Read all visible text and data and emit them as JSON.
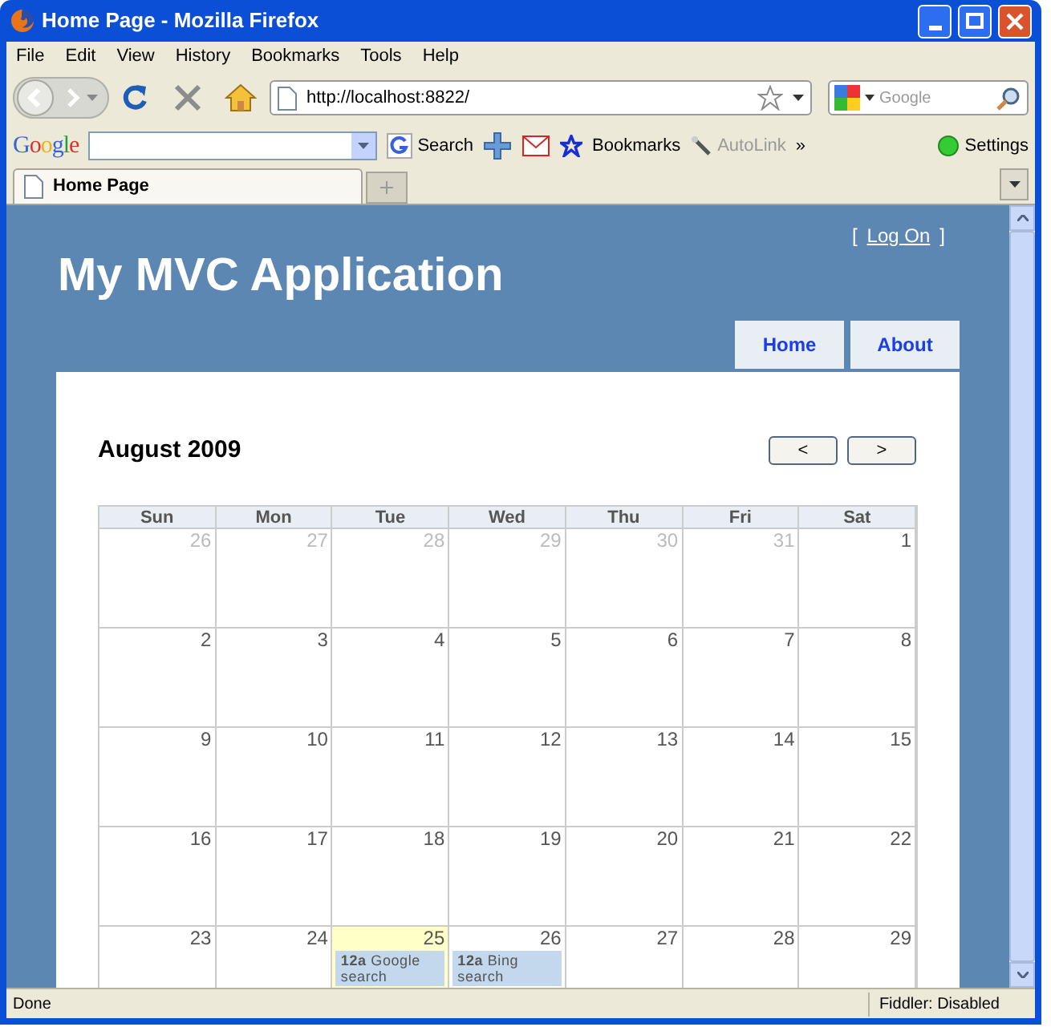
{
  "window": {
    "title": "Home Page - Mozilla Firefox"
  },
  "menu": [
    "File",
    "Edit",
    "View",
    "History",
    "Bookmarks",
    "Tools",
    "Help"
  ],
  "nav": {
    "url": "http://localhost:8822/",
    "search_placeholder": "Google"
  },
  "google_toolbar": {
    "logo": "Google",
    "items": [
      {
        "kind": "search",
        "label": "Search",
        "disabled": false
      },
      {
        "kind": "bookmarks",
        "label": "Bookmarks",
        "disabled": false
      },
      {
        "kind": "autolink",
        "label": "AutoLink",
        "disabled": true
      },
      {
        "kind": "more",
        "label": "»",
        "disabled": false
      }
    ],
    "settings": "Settings"
  },
  "tabs": [
    {
      "title": "Home Page",
      "selected": true
    }
  ],
  "page": {
    "log_on": {
      "before": "[",
      "link": "Log On",
      "after": "]"
    },
    "title": "My MVC Application",
    "menu": [
      {
        "label": "Home",
        "selected": false
      },
      {
        "label": "About",
        "selected": false
      }
    ],
    "calendar": {
      "month": "August 2009",
      "prev": "<",
      "next": ">",
      "weekdays": [
        "Sun",
        "Mon",
        "Tue",
        "Wed",
        "Thu",
        "Fri",
        "Sat"
      ],
      "weeks": [
        [
          {
            "day": "26",
            "other_month": true
          },
          {
            "day": "27",
            "other_month": true
          },
          {
            "day": "28",
            "other_month": true
          },
          {
            "day": "29",
            "other_month": true
          },
          {
            "day": "30",
            "other_month": true
          },
          {
            "day": "31",
            "other_month": true
          },
          {
            "day": "1",
            "other_month": false
          }
        ],
        [
          {
            "day": "2",
            "other_month": false
          },
          {
            "day": "3",
            "other_month": false
          },
          {
            "day": "4",
            "other_month": false
          },
          {
            "day": "5",
            "other_month": false
          },
          {
            "day": "6",
            "other_month": false
          },
          {
            "day": "7",
            "other_month": false
          },
          {
            "day": "8",
            "other_month": false
          }
        ],
        [
          {
            "day": "9",
            "other_month": false
          },
          {
            "day": "10",
            "other_month": false
          },
          {
            "day": "11",
            "other_month": false
          },
          {
            "day": "12",
            "other_month": false
          },
          {
            "day": "13",
            "other_month": false
          },
          {
            "day": "14",
            "other_month": false
          },
          {
            "day": "15",
            "other_month": false
          }
        ],
        [
          {
            "day": "16",
            "other_month": false
          },
          {
            "day": "17",
            "other_month": false
          },
          {
            "day": "18",
            "other_month": false
          },
          {
            "day": "19",
            "other_month": false
          },
          {
            "day": "20",
            "other_month": false
          },
          {
            "day": "21",
            "other_month": false
          },
          {
            "day": "22",
            "other_month": false
          }
        ],
        [
          {
            "day": "23",
            "other_month": false
          },
          {
            "day": "24",
            "other_month": false
          },
          {
            "day": "25",
            "other_month": false,
            "today": true,
            "events": [
              {
                "time": "12a",
                "title": "Google search"
              }
            ]
          },
          {
            "day": "26",
            "other_month": false,
            "events": [
              {
                "time": "12a",
                "title": "Bing search"
              }
            ]
          },
          {
            "day": "27",
            "other_month": false
          },
          {
            "day": "28",
            "other_month": false
          },
          {
            "day": "29",
            "other_month": false
          }
        ]
      ]
    }
  },
  "status_bar": {
    "text": "Done",
    "panel": "Fiddler: Disabled"
  }
}
